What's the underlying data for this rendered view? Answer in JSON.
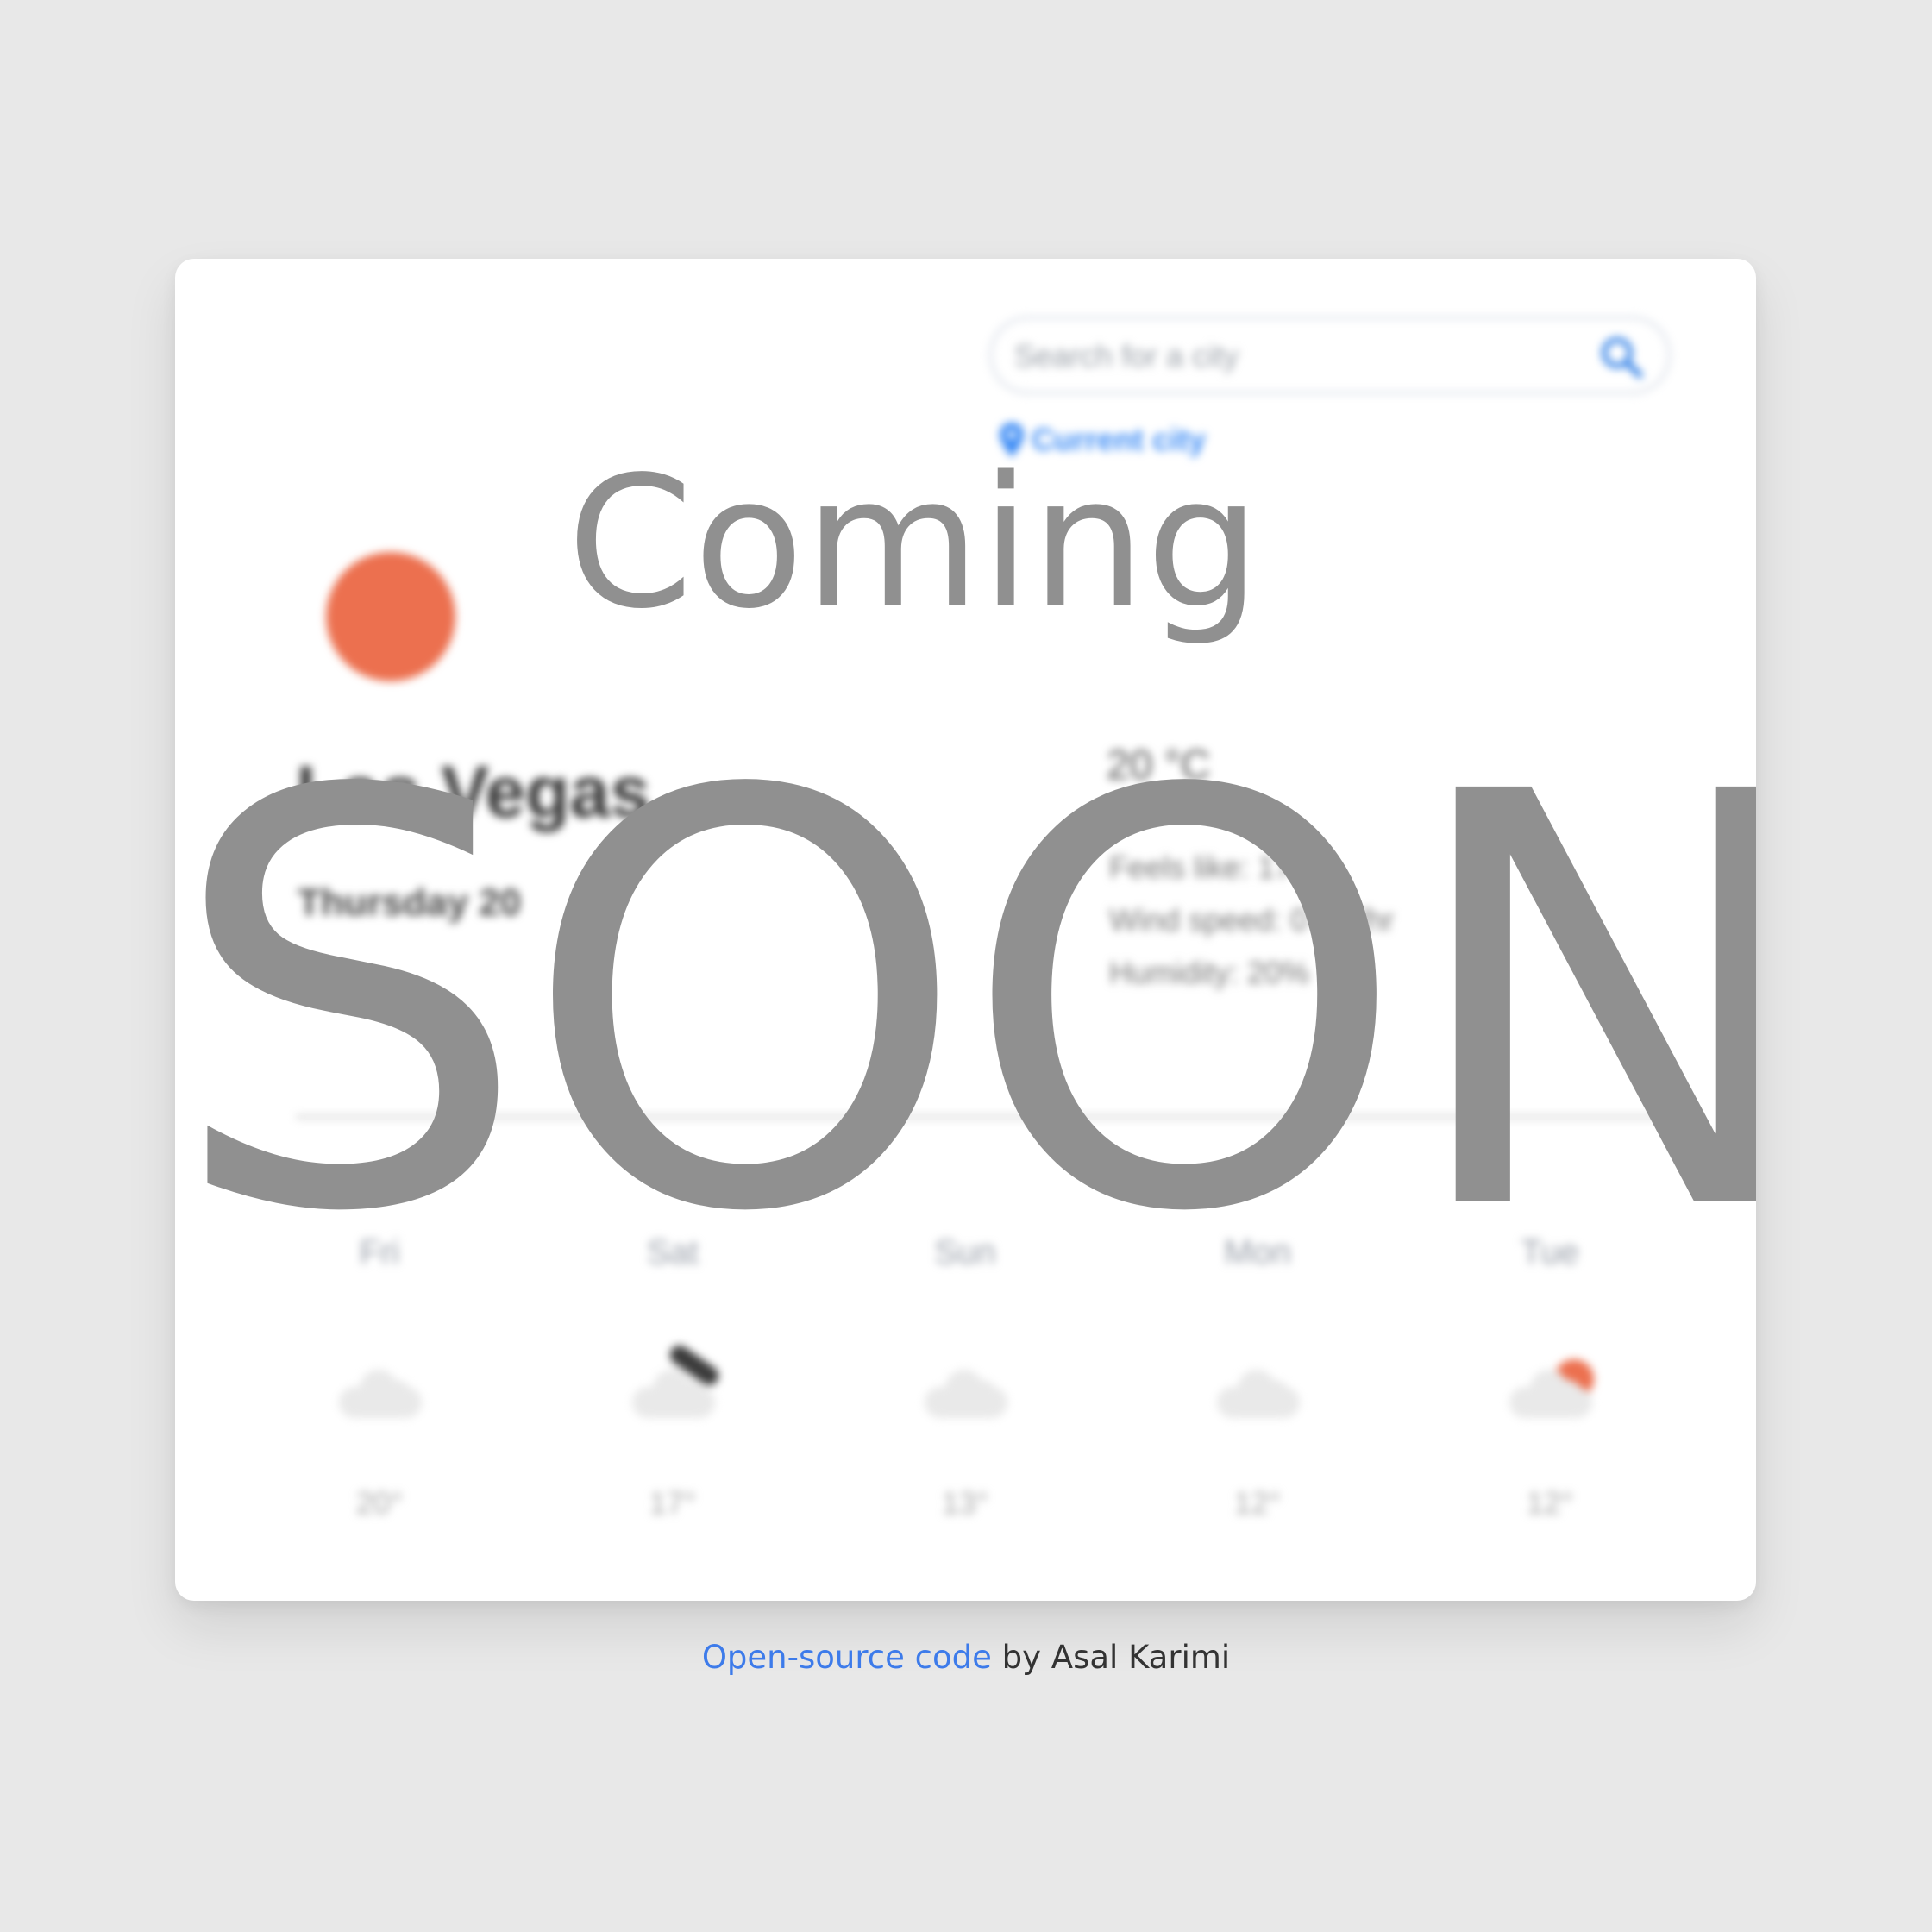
{
  "search": {
    "placeholder": "Search for a city",
    "icon": "search-icon"
  },
  "current_city": {
    "label": "Current city",
    "icon": "map-pin-icon"
  },
  "weather": {
    "icon": "sun-icon",
    "city": "Las Vegas",
    "date": "Thursday 20",
    "temperature": "20 °C",
    "feels_like": "Feels like: 17°C",
    "wind_speed": "Wind speed: 0 km/hr",
    "humidity": "Humidity: 20%"
  },
  "forecast": [
    {
      "day": "Fri",
      "icon": "cloud-icon",
      "temp": "20°"
    },
    {
      "day": "Sat",
      "icon": "cloud-rain-icon",
      "temp": "17°"
    },
    {
      "day": "Sun",
      "icon": "cloud-icon",
      "temp": "13°"
    },
    {
      "day": "Mon",
      "icon": "cloud-icon",
      "temp": "12°"
    },
    {
      "day": "Tue",
      "icon": "cloud-sun-icon",
      "temp": "12°"
    }
  ],
  "overlay": {
    "line1": "Coming",
    "line2": "SOON!"
  },
  "footer": {
    "link_text": "Open-source code",
    "suffix": " by Asal Karimi"
  },
  "colors": {
    "background": "#e8e8e8",
    "accent": "#3d8cf5",
    "sun": "#ec704f",
    "overlay_text": "#909090",
    "link": "#3d7bea"
  }
}
